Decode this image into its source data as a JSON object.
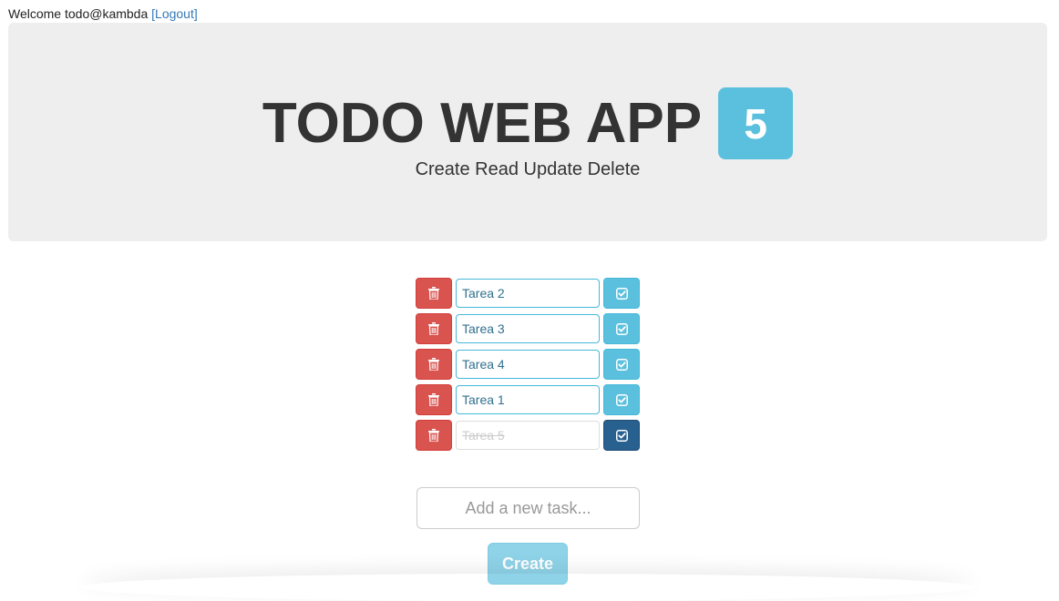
{
  "header": {
    "welcome_text": "Welcome todo@kambda",
    "logout_label": "[Logout]"
  },
  "jumbotron": {
    "title": "TODO WEB APP",
    "count": "5",
    "subtitle": "Create Read Update Delete"
  },
  "tasks": [
    {
      "label": "Tarea 2",
      "done": false
    },
    {
      "label": "Tarea 3",
      "done": false
    },
    {
      "label": "Tarea 4",
      "done": false
    },
    {
      "label": "Tarea 1",
      "done": false
    },
    {
      "label": "Tarea 5",
      "done": true
    }
  ],
  "new_task": {
    "placeholder": "Add a new task...",
    "value": ""
  },
  "create_button": {
    "label": "Create"
  },
  "colors": {
    "delete": "#d9534f",
    "info": "#5bc0de",
    "done": "#286090",
    "jumbotron_bg": "#eeeeee"
  },
  "icons": {
    "delete": "trash-icon",
    "complete": "check-square-icon"
  }
}
